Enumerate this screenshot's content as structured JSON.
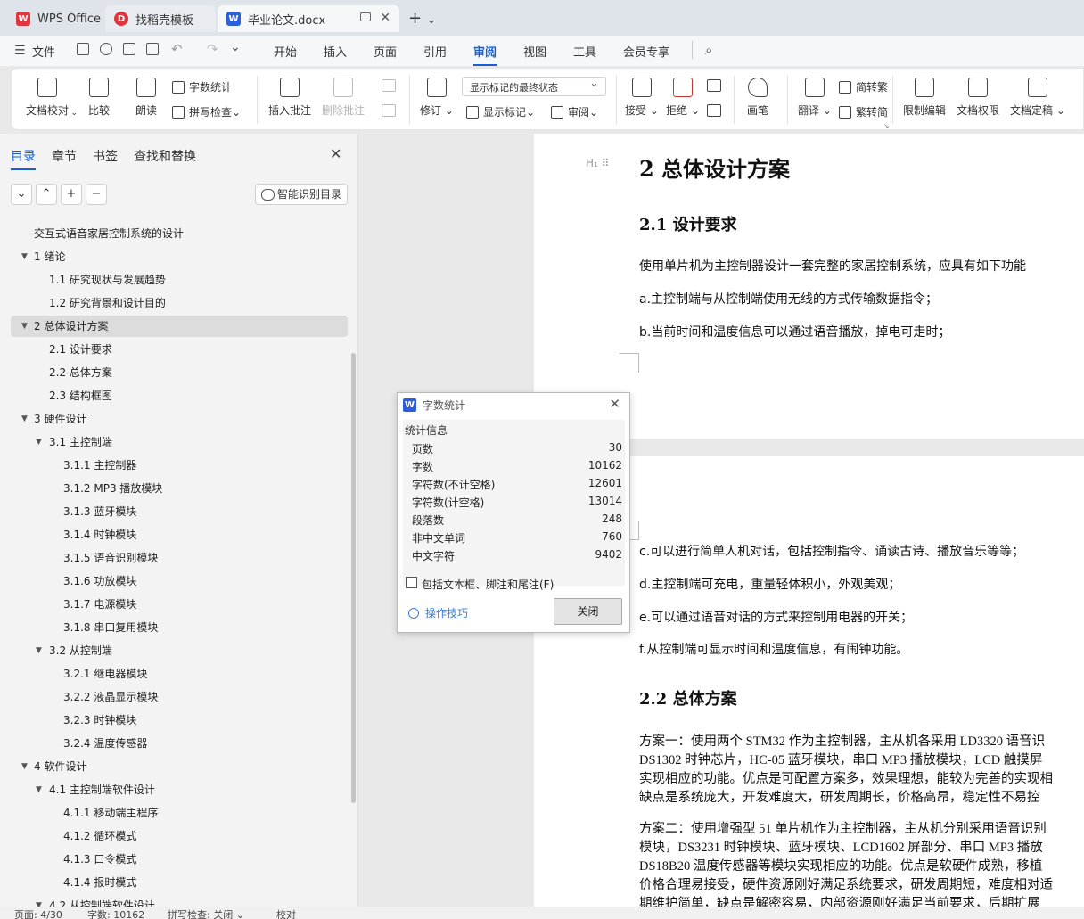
{
  "tabs": [
    {
      "label": "WPS Office",
      "icon": "wps-logo-icon"
    },
    {
      "label": "找稻壳模板",
      "icon": "docer-icon"
    },
    {
      "label": "毕业论文.docx",
      "icon": "word-doc-icon"
    }
  ],
  "menu": {
    "file": "文件",
    "items": [
      "开始",
      "插入",
      "页面",
      "引用",
      "审阅",
      "视图",
      "工具",
      "会员专享"
    ],
    "active": "审阅"
  },
  "ribbon": {
    "doc_check": "文档校对",
    "compare": "比较",
    "read_aloud": "朗读",
    "word_count": "字数统计",
    "spell_check": "拼写检查",
    "insert_comment": "插入批注",
    "delete_comment": "删除批注",
    "revise": "修订",
    "markup_state": "显示标记的最终状态",
    "show_markup": "显示标记",
    "review_pane": "审阅",
    "accept": "接受",
    "reject": "拒绝",
    "ink": "画笔",
    "translate": "翻译",
    "to_traditional": "简转繁",
    "to_simplified": "繁转简",
    "restrict_edit": "限制编辑",
    "doc_permission": "文档权限",
    "doc_finalize": "文档定稿"
  },
  "nav": {
    "tabs": [
      "目录",
      "章节",
      "书签",
      "查找和替换"
    ],
    "smart_toc": "智能识别目录",
    "controls": [
      "⌄",
      "⌃",
      "+",
      "−"
    ],
    "toc": [
      {
        "label": "交互式语音家居控制系统的设计"
      },
      {
        "num": "1",
        "label": "绪论"
      },
      {
        "num": "1.1",
        "label": "研究现状与发展趋势"
      },
      {
        "num": "1.2",
        "label": "研究背景和设计目的"
      },
      {
        "num": "2",
        "label": "总体设计方案"
      },
      {
        "num": "2.1",
        "label": "设计要求"
      },
      {
        "num": "2.2",
        "label": "总体方案"
      },
      {
        "num": "2.3",
        "label": "结构框图"
      },
      {
        "num": "3",
        "label": "硬件设计"
      },
      {
        "num": "3.1",
        "label": "主控制端"
      },
      {
        "num": "3.1.1",
        "label": "主控制器"
      },
      {
        "num": "3.1.2",
        "label": "MP3 播放模块"
      },
      {
        "num": "3.1.3",
        "label": "蓝牙模块"
      },
      {
        "num": "3.1.4",
        "label": "时钟模块"
      },
      {
        "num": "3.1.5",
        "label": "语音识别模块"
      },
      {
        "num": "3.1.6",
        "label": "功放模块"
      },
      {
        "num": "3.1.7",
        "label": "电源模块"
      },
      {
        "num": "3.1.8",
        "label": "串口复用模块"
      },
      {
        "num": "3.2",
        "label": "从控制端"
      },
      {
        "num": "3.2.1",
        "label": "继电器模块"
      },
      {
        "num": "3.2.2",
        "label": "液晶显示模块"
      },
      {
        "num": "3.2.3",
        "label": "时钟模块"
      },
      {
        "num": "3.2.4",
        "label": "温度传感器"
      },
      {
        "num": "4",
        "label": "软件设计"
      },
      {
        "num": "4.1",
        "label": "主控制端软件设计"
      },
      {
        "num": "4.1.1",
        "label": "移动端主程序"
      },
      {
        "num": "4.1.2",
        "label": "循环模式"
      },
      {
        "num": "4.1.3",
        "label": "口令模式"
      },
      {
        "num": "4.1.4",
        "label": "报时模式"
      },
      {
        "num": "4.2",
        "label": "从控制端软件设计"
      }
    ]
  },
  "document": {
    "page1": {
      "h1": "2  总体设计方案",
      "h2": "2.1  设计要求",
      "p1": "使用单片机为主控制器设计一套完整的家居控制系统，应具有如下功能",
      "p2": "a.主控制端与从控制端使用无线的方式传输数据指令；",
      "p3": "b.当前时间和温度信息可以通过语音播放，掉电可走时；"
    },
    "page2": {
      "c": "c.可以进行简单人机对话，包括控制指令、诵读古诗、播放音乐等等；",
      "d": "d.主控制端可充电，重量轻体积小，外观美观；",
      "e": "e.可以通过语音对话的方式来控制用电器的开关；",
      "f": "f.从控制端可显示时间和温度信息，有闹钟功能。",
      "h2": "2.2  总体方案",
      "s1": "方案一：使用两个 STM32 作为主控制器，主从机各采用 LD3320 语音识",
      "s2": "DS1302 时钟芯片，HC-05 蓝牙模块，串口 MP3 播放模块，LCD 触摸屏",
      "s3": "实现相应的功能。优点是可配置方案多，效果理想，能较为完善的实现相",
      "s4": "缺点是系统庞大，开发难度大，研发周期长，价格高昂，稳定性不易控",
      "t1": "方案二：使用增强型 51 单片机作为主控制器，主从机分别采用语音识别",
      "t2": "模块，DS3231 时钟模块、蓝牙模块、LCD1602 屏部分、串口 MP3 播放",
      "t3": "DS18B20 温度传感器等模块实现相应的功能。优点是软硬件成熟，移植",
      "t4": "价格合理易接受，硬件资源刚好满足系统要求，研发周期短，难度相对适",
      "t5": "期维护简单，缺点是解密容易，内部资源刚好满足当前要求，后期扩展"
    }
  },
  "dialog": {
    "title": "字数统计",
    "section": "统计信息",
    "rows": [
      {
        "label": "页数",
        "value": "30"
      },
      {
        "label": "字数",
        "value": "10162"
      },
      {
        "label": "字符数(不计空格)",
        "value": "12601"
      },
      {
        "label": "字符数(计空格)",
        "value": "13014"
      },
      {
        "label": "段落数",
        "value": "248"
      },
      {
        "label": "非中文单词",
        "value": "760"
      },
      {
        "label": "中文字符",
        "value": "9402"
      }
    ],
    "checkbox_label": "包括文本框、脚注和尾注(F)",
    "checkbox_checked": false,
    "tips": "操作技巧",
    "close": "关闭"
  },
  "status": {
    "page": "页面: 4/30",
    "words": "字数: 10162",
    "spell": "拼写检查: 关闭",
    "proof": "校对"
  },
  "colors": {
    "accent": "#1a5fd0",
    "wps_red": "#e0353b",
    "word_blue": "#2c5fd8"
  }
}
